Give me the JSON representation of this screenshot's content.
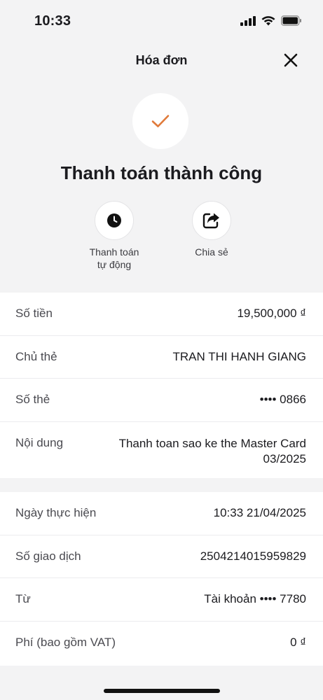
{
  "status_bar": {
    "time": "10:33"
  },
  "header": {
    "title": "Hóa đơn"
  },
  "result": {
    "title": "Thanh toán thành công",
    "accent_color": "#e07a3a"
  },
  "actions": [
    {
      "label": "Thanh toán\ntự động",
      "icon": "clock-icon"
    },
    {
      "label": "Chia sẻ",
      "icon": "share-icon"
    }
  ],
  "details": [
    {
      "label": "Số tiền",
      "value": "19,500,000 ₫"
    },
    {
      "label": "Chủ thẻ",
      "value": "TRAN THI HANH GIANG"
    },
    {
      "label": "Số thẻ",
      "value": "•••• 0866"
    },
    {
      "label": "Nội dung",
      "value": "Thanh toan sao ke the Master Card 03/2025"
    }
  ],
  "transaction": [
    {
      "label": "Ngày thực hiện",
      "value": "10:33 21/04/2025"
    },
    {
      "label": "Số giao dịch",
      "value": "2504214015959829"
    },
    {
      "label": "Từ",
      "value": "Tài khoản •••• 7780"
    },
    {
      "label": "Phí (bao gồm VAT)",
      "value": "0 ₫"
    }
  ]
}
